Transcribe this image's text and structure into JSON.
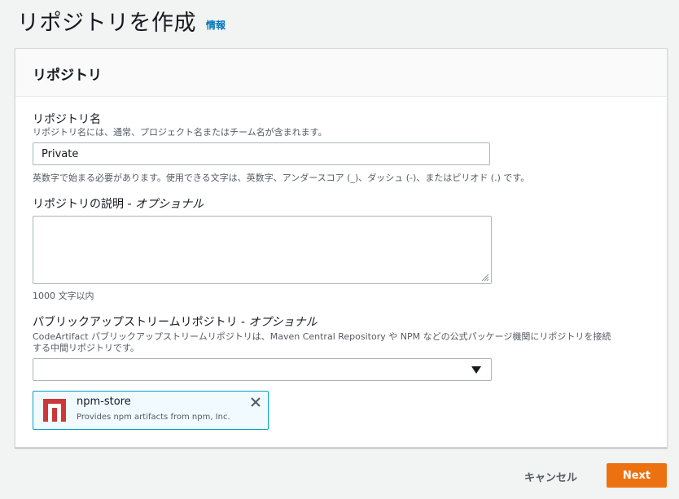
{
  "page": {
    "title": "リポジトリを作成",
    "info_link": "情報"
  },
  "panel": {
    "header": "リポジトリ",
    "name_field": {
      "label": "リポジトリ名",
      "description": "リポジトリ名には、通常、プロジェクト名またはチーム名が含まれます。",
      "value": "Private",
      "constraint": "英数字で始まる必要があります。使用できる文字は、英数字、アンダースコア (_)、ダッシュ (-)、またはピリオド (.) です。"
    },
    "description_field": {
      "label": "リポジトリの説明 - ",
      "label_optional": "オプショナル",
      "value": "",
      "constraint": "1000 文字以内"
    },
    "upstream_field": {
      "label": "パブリックアップストリームリポジトリ - ",
      "label_optional": "オプショナル",
      "description_line1": "CodeArtifact パブリックアップストリームリポジトリは、Maven Central Repository や NPM などの公式パッケージ機関にリポジトリを接続",
      "description_line2": "する中間リポジトリです。",
      "selected_value": "",
      "token": {
        "title": "npm-store",
        "description": "Provides npm artifacts from npm, Inc.",
        "icon": "npm-logo-icon"
      }
    }
  },
  "footer": {
    "cancel_label": "キャンセル",
    "next_label": "Next"
  },
  "colors": {
    "primary_button": "#ec7211",
    "link": "#0073bb",
    "token_border": "#00a1c9",
    "npm_red": "#cb3837"
  }
}
